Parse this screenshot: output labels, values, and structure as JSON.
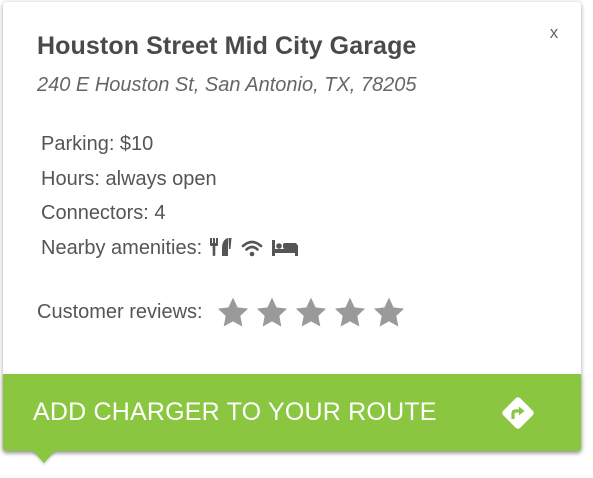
{
  "card": {
    "close_label": "x",
    "title": "Houston Street Mid City Garage",
    "address": "240 E Houston St, San Antonio, TX, 78205"
  },
  "details": {
    "parking": "Parking: $10",
    "hours": "Hours: always open",
    "connectors": "Connectors: 4",
    "amenities_label": "Nearby amenities:",
    "amenities": [
      "restaurant-icon",
      "wifi-icon",
      "hotel-icon"
    ]
  },
  "reviews": {
    "label": "Customer reviews:",
    "rating": 0,
    "max_stars": 5
  },
  "cta": {
    "label": "ADD CHARGER TO YOUR ROUTE",
    "icon": "directions-icon"
  },
  "colors": {
    "accent": "#8bc641",
    "title_text": "#4a4a4a",
    "body_text": "#555555",
    "icon_gray": "#555555",
    "star_empty": "#9a9a9a"
  }
}
